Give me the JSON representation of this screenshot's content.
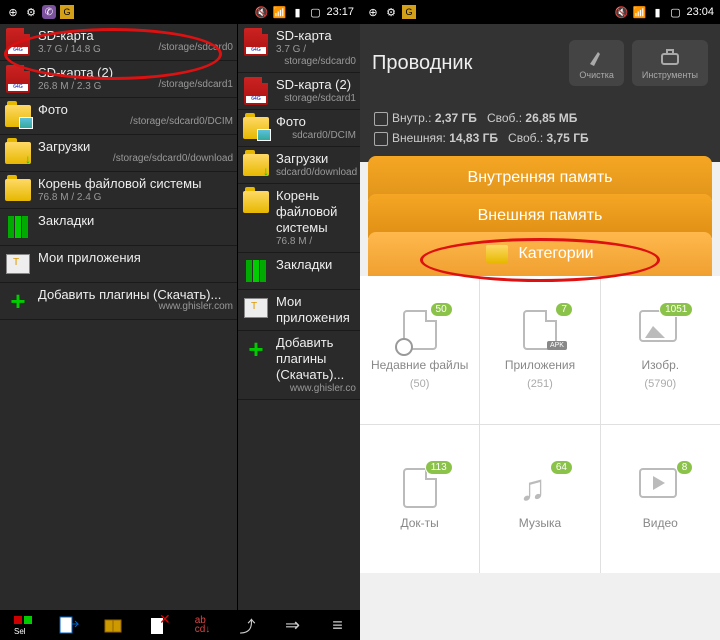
{
  "left": {
    "status": {
      "time": "23:17"
    },
    "paneA": [
      {
        "icon": "sd",
        "title": "SD-карта",
        "sub": "3.7 G / 14.8 G",
        "path": "/storage/sdcard0"
      },
      {
        "icon": "sd",
        "title": "SD-карта (2)",
        "sub": "26.8 M / 2.3 G",
        "path": "/storage/sdcard1"
      },
      {
        "icon": "folder-photo",
        "title": "Фото",
        "sub": "",
        "path": "/storage/sdcard0/DCIM"
      },
      {
        "icon": "folder-dl",
        "title": "Загрузки",
        "sub": "",
        "path": "/storage/sdcard0/download"
      },
      {
        "icon": "folder",
        "title": "Корень файловой системы",
        "sub": "76.8 M / 2.4 G",
        "path": ""
      },
      {
        "icon": "bookmarks",
        "title": "Закладки",
        "sub": "",
        "path": ""
      },
      {
        "icon": "apps",
        "title": "Мои приложения",
        "sub": "",
        "path": ""
      },
      {
        "icon": "plus",
        "title": "Добавить плагины (Скачать)...",
        "sub": "",
        "path": "www.ghisler.com"
      }
    ],
    "paneB": [
      {
        "icon": "sd",
        "title": "SD-карта",
        "sub": "3.7 G /",
        "path": "storage/sdcard0"
      },
      {
        "icon": "sd",
        "title": "SD-карта (2)",
        "sub": "",
        "path": "storage/sdcard1"
      },
      {
        "icon": "folder-photo",
        "title": "Фото",
        "sub": "",
        "path": "sdcard0/DCIM"
      },
      {
        "icon": "folder-dl",
        "title": "Загрузки",
        "sub": "",
        "path": "sdcard0/download"
      },
      {
        "icon": "folder",
        "title": "Корень файловой системы",
        "sub": "76.8 M /",
        "path": ""
      },
      {
        "icon": "bookmarks",
        "title": "Закладки",
        "sub": "",
        "path": ""
      },
      {
        "icon": "apps",
        "title": "Мои приложения",
        "sub": "",
        "path": ""
      },
      {
        "icon": "plus",
        "title": "Добавить плагины (Скачать)...",
        "sub": "",
        "path": "www.ghisler.co"
      }
    ],
    "toolbar": [
      "sel",
      "copy",
      "pack",
      "delete",
      "sort",
      "up",
      "arrow",
      "menu"
    ]
  },
  "right": {
    "status": {
      "time": "23:04"
    },
    "header": {
      "title": "Проводник",
      "btn1": "Очистка",
      "btn2": "Инструменты"
    },
    "storage": {
      "line1": {
        "label": "Внутр.:",
        "total": "2,37 ГБ",
        "freeLabel": "Своб.:",
        "free": "26,85 МБ"
      },
      "line2": {
        "label": "Внешняя:",
        "total": "14,83 ГБ",
        "freeLabel": "Своб.:",
        "free": "3,75 ГБ"
      }
    },
    "tabs": {
      "t1": "Внутренняя память",
      "t2": "Внешняя память",
      "t3": "Категории"
    },
    "grid": [
      {
        "label": "Недавние файлы",
        "count": "(50)",
        "badge": "50",
        "icon": "recent"
      },
      {
        "label": "Приложения",
        "count": "(251)",
        "badge": "7",
        "icon": "apk"
      },
      {
        "label": "Изобр.",
        "count": "(5790)",
        "badge": "1051",
        "icon": "image"
      },
      {
        "label": "Док-ты",
        "count": "",
        "badge": "113",
        "icon": "doc"
      },
      {
        "label": "Музыка",
        "count": "",
        "badge": "64",
        "icon": "music"
      },
      {
        "label": "Видео",
        "count": "",
        "badge": "8",
        "icon": "video"
      }
    ]
  }
}
